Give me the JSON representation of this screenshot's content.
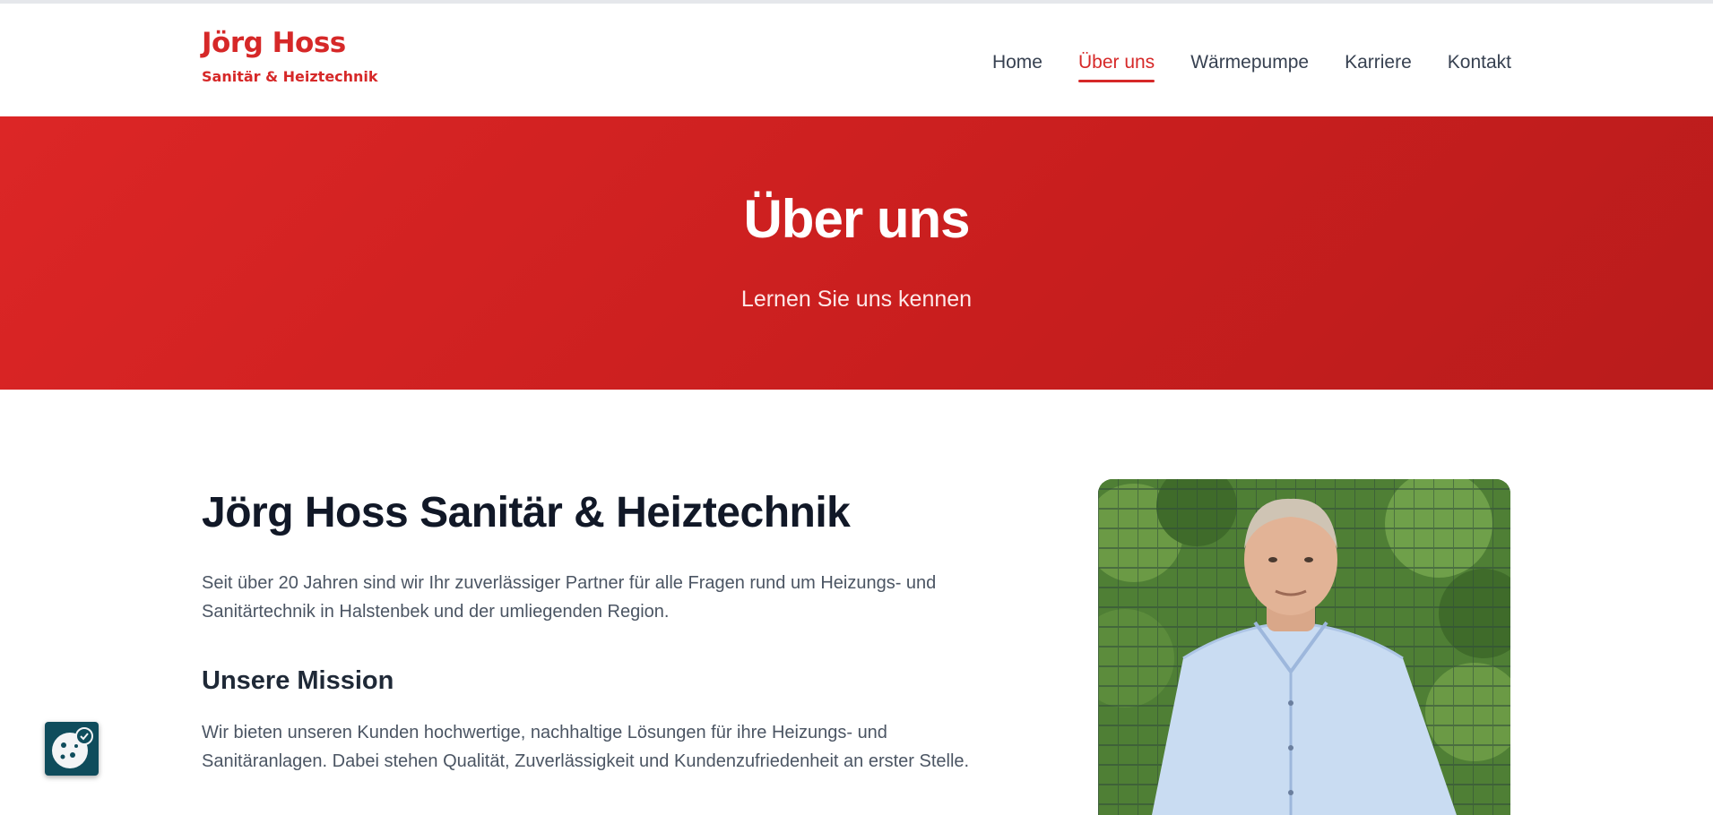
{
  "brand": {
    "name": "Jörg Hoss",
    "tagline": "Sanitär & Heiztechnik"
  },
  "nav": {
    "items": [
      {
        "label": "Home"
      },
      {
        "label": "Über uns"
      },
      {
        "label": "Wärmepumpe"
      },
      {
        "label": "Karriere"
      },
      {
        "label": "Kontakt"
      }
    ],
    "active": "Über uns"
  },
  "hero": {
    "title": "Über uns",
    "subtitle": "Lernen Sie uns kennen"
  },
  "main": {
    "heading": "Jörg Hoss Sanitär & Heiztechnik",
    "intro_line1": "Seit über 20 Jahren sind wir Ihr zuverlässiger Partner für alle Fragen rund um Heizungs- und",
    "intro_line2": "Sanitärtechnik in Halstenbek und der umliegenden Region.",
    "mission_heading": "Unsere Mission",
    "mission_line1": "Wir bieten unseren Kunden hochwertige, nachhaltige Lösungen für ihre Heizungs- und",
    "mission_line2": "Sanitäranlagen. Dabei stehen Qualität, Zuverlässigkeit und Kundenzufriedenheit an erster Stelle."
  },
  "icons": {
    "cookie_settings": "cookie-settings-icon"
  },
  "colors": {
    "brand_red": "#d62828",
    "hero_red": "#c81e1e",
    "cookie_bg": "#0f4c5c"
  }
}
